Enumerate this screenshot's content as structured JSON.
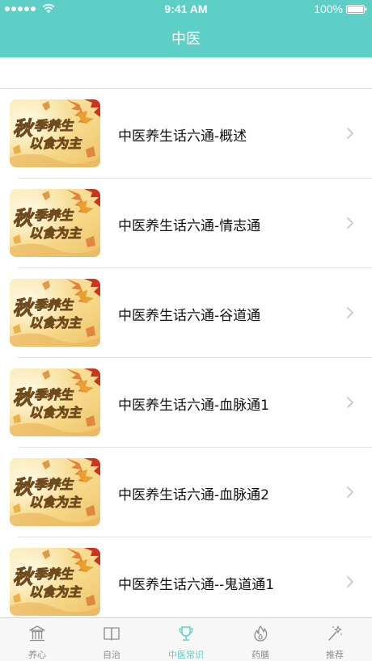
{
  "status_bar": {
    "time": "9:41 AM",
    "battery": "100%"
  },
  "nav": {
    "title": "中医"
  },
  "articles": [
    {
      "title": "中医养生话六通-概述"
    },
    {
      "title": "中医养生话六通-情志通"
    },
    {
      "title": "中医养生话六通-谷道通"
    },
    {
      "title": "中医养生话六通-血脉通1"
    },
    {
      "title": "中医养生话六通-血脉通2"
    },
    {
      "title": "中医养生话六通--鬼道通1"
    }
  ],
  "thumbnail": {
    "text_line1": "秋季养生",
    "text_line2": "以食为主",
    "icon": "autumn-leaves-banner"
  },
  "tabs": [
    {
      "label": "养心",
      "icon": "temple-icon",
      "active": false
    },
    {
      "label": "自治",
      "icon": "book-icon",
      "active": false
    },
    {
      "label": "中医常识",
      "icon": "trophy-icon",
      "active": true
    },
    {
      "label": "药膳",
      "icon": "flame-icon",
      "active": false
    },
    {
      "label": "推荐",
      "icon": "magic-wand-icon",
      "active": false
    }
  ],
  "colors": {
    "brand": "#5ecfc6",
    "tab_inactive": "#8e8e8e",
    "divider": "#e3e3e3"
  }
}
